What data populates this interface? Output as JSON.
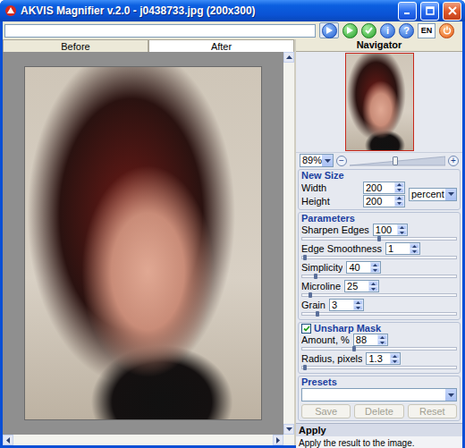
{
  "window": {
    "title": "AKVIS Magnifier v.2.0 - j0438733.jpg (200x300)"
  },
  "toolbar": {
    "path": "",
    "info_icon": "i",
    "help_icon": "?",
    "language": "EN"
  },
  "tabs": [
    {
      "label": "Before",
      "selected": false
    },
    {
      "label": "After",
      "selected": true
    }
  ],
  "navigator": {
    "title": "Navigator",
    "zoom": "89%",
    "zoom_out": "−",
    "zoom_in": "+",
    "zoom_level": 0.48
  },
  "new_size": {
    "title": "New Size",
    "fields": [
      {
        "label": "Width",
        "value": "200"
      },
      {
        "label": "Height",
        "value": "200"
      }
    ],
    "unit": "percent"
  },
  "parameters": {
    "title": "Parameters",
    "items": [
      {
        "label": "Sharpen Edges",
        "value": "100",
        "level": 0.5
      },
      {
        "label": "Edge Smoothness",
        "value": "1",
        "level": 0.02
      },
      {
        "label": "Simplicity",
        "value": "40",
        "level": 0.09
      },
      {
        "label": "Microline",
        "value": "25",
        "level": 0.05
      },
      {
        "label": "Grain",
        "value": "3",
        "level": 0.1
      }
    ]
  },
  "unsharp_mask": {
    "title": "Unsharp Mask",
    "checked": true,
    "items": [
      {
        "label": "Amount, %",
        "value": "88",
        "level": 0.34
      },
      {
        "label": "Radius, pixels",
        "value": "1.3",
        "level": 0.02
      }
    ]
  },
  "presets": {
    "title": "Presets",
    "value": "",
    "buttons": [
      {
        "label": "Save",
        "disabled": true
      },
      {
        "label": "Delete",
        "disabled": true
      },
      {
        "label": "Reset",
        "disabled": true
      }
    ]
  },
  "help": {
    "title": "Apply",
    "text": "Apply the result to the image."
  }
}
